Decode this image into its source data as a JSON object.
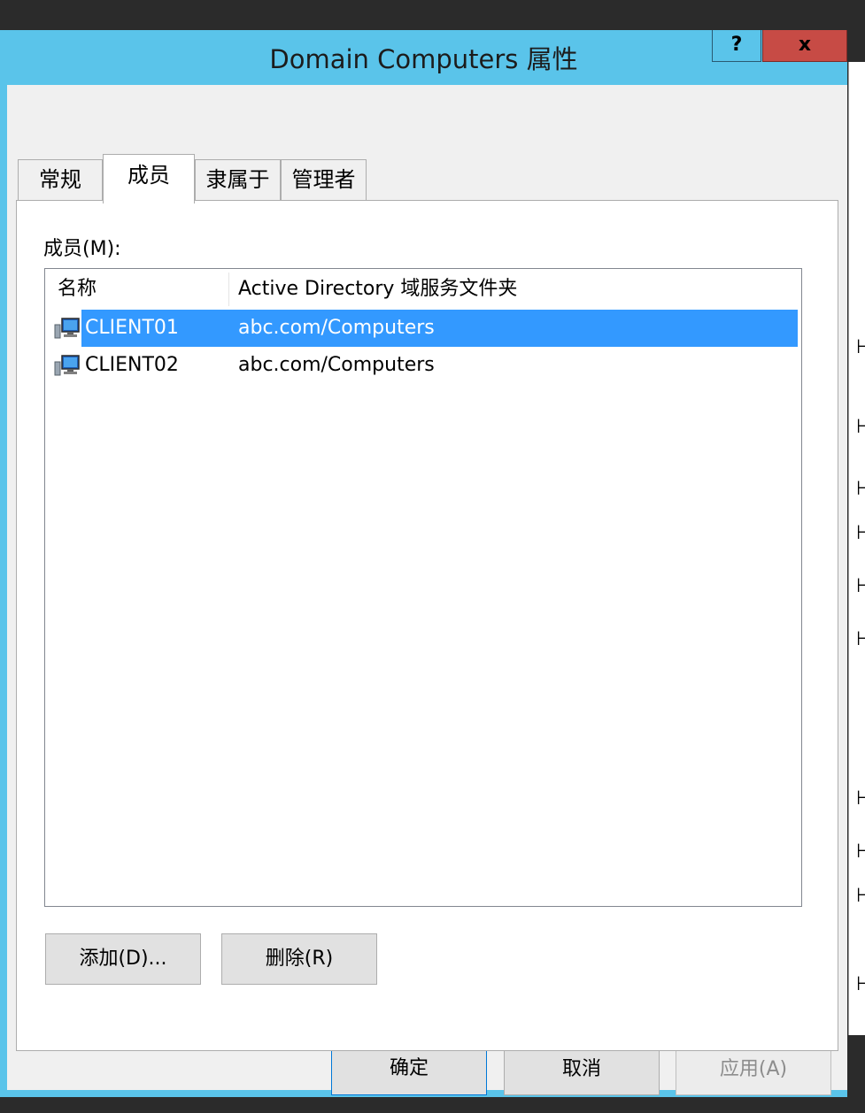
{
  "window": {
    "title": "Domain Computers 属性",
    "help_label": "?",
    "close_label": "x"
  },
  "tabs": [
    {
      "label": "常规",
      "active": false
    },
    {
      "label": "成员",
      "active": true
    },
    {
      "label": "隶属于",
      "active": false
    },
    {
      "label": "管理者",
      "active": false
    }
  ],
  "members": {
    "label": "成员(M):",
    "columns": [
      "名称",
      "Active Directory 域服务文件夹"
    ],
    "rows": [
      {
        "icon": "computer-icon",
        "name": "CLIENT01",
        "folder": "abc.com/Computers",
        "selected": true
      },
      {
        "icon": "computer-icon",
        "name": "CLIENT02",
        "folder": "abc.com/Computers",
        "selected": false
      }
    ],
    "add_label": "添加(D)...",
    "remove_label": "删除(R)"
  },
  "footer": {
    "ok_label": "确定",
    "cancel_label": "取消",
    "apply_label": "应用(A)"
  },
  "colors": {
    "titlebar": "#5ac4ea",
    "close_button": "#c74b45",
    "selection": "#3399ff"
  }
}
